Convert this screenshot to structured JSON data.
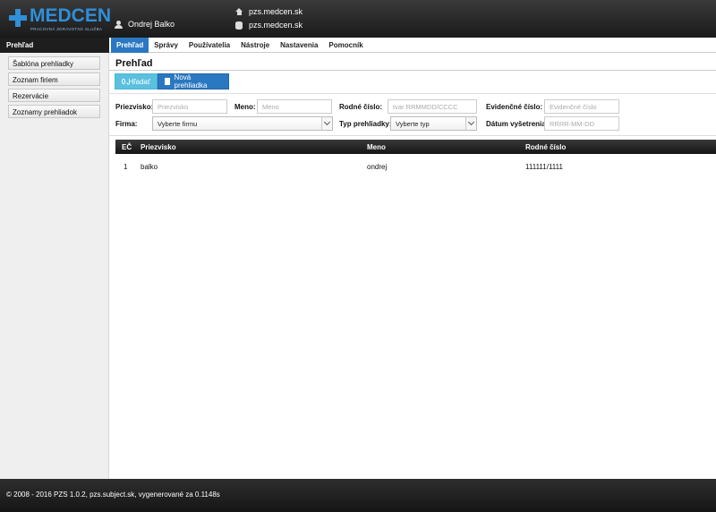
{
  "header": {
    "logo_text": "MEDCEN",
    "logo_tagline": "PRACOVNÁ ZDRAVOTNÁ SLUŽBA",
    "user_name": "Ondrej Balko",
    "host_home": "pzs.medcen.sk",
    "host_db": "pzs.medcen.sk"
  },
  "nav": {
    "section_title": "Prehľad",
    "tabs": [
      "Prehľad",
      "Správy",
      "Používatelia",
      "Nástroje",
      "Nastavenia",
      "Pomocník"
    ]
  },
  "sidebar": {
    "items": [
      "Šablóna prehliadky",
      "Zoznam firiem",
      "Rezervácie",
      "Zoznamy prehliadok"
    ]
  },
  "main": {
    "title": "Prehľad",
    "buttons": {
      "search": "Hľadať",
      "new": "Nová prehliadka"
    },
    "filters": {
      "surname_label": "Priezvisko:",
      "surname_placeholder": "Priezvisko",
      "name_label": "Meno:",
      "name_placeholder": "Meno",
      "birth_label": "Rodné číslo:",
      "birth_placeholder": "tvar RRMMDD/CCCC",
      "evid_label": "Evidenčné číslo:",
      "evid_placeholder": "Evidenčné číslo",
      "firm_label": "Firma:",
      "firm_value": "Vyberte firmu",
      "type_label": "Typ prehliadky:",
      "type_value": "Vyberte typ",
      "date_label": "Dátum vyšetrenia:",
      "date_placeholder": "RRRR-MM-DD"
    },
    "table": {
      "columns": [
        "EČ",
        "Priezvisko",
        "Meno",
        "Rodné číslo"
      ],
      "rows": [
        [
          "1",
          "balko",
          "ondrej",
          "111111/1111"
        ]
      ]
    }
  },
  "footer": {
    "text": "© 2008 - 2016 PZS 1.0.2, pzs.subject.sk, vygenerované za 0.1148s"
  },
  "colors": {
    "accent": "#2a78c2",
    "search_button": "#5bc0de",
    "header": "#1a1a1a"
  }
}
